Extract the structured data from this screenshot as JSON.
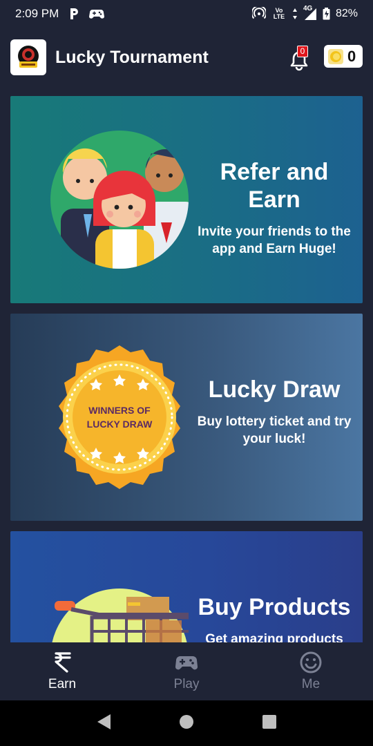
{
  "status_bar": {
    "time": "2:09 PM",
    "network": "4G",
    "volte": "Vo LTE",
    "battery": "82%",
    "icons": [
      "parking-icon",
      "gamepad-icon",
      "hotspot-icon",
      "volte-icon",
      "signal-icon",
      "battery-icon"
    ]
  },
  "app_bar": {
    "title": "Lucky Tournament",
    "notification_count": "0",
    "coin_balance": "0"
  },
  "cards": [
    {
      "title": "Refer and Earn",
      "description": "Invite your friends to the app and Earn Huge!",
      "art": "people-illustration"
    },
    {
      "title": "Lucky Draw",
      "description": "Buy lottery ticket and try your luck!",
      "art": "medal-illustration",
      "medal_text": "WINNERS OF LUCKY DRAW"
    },
    {
      "title": "Buy Products",
      "description": "Get amazing products",
      "art": "shopping-cart-illustration"
    }
  ],
  "bottom_nav": [
    {
      "label": "Earn",
      "icon": "rupee-icon",
      "active": true
    },
    {
      "label": "Play",
      "icon": "gamepad-icon",
      "active": false
    },
    {
      "label": "Me",
      "icon": "smiley-icon",
      "active": false
    }
  ],
  "colors": {
    "background": "#1f2436",
    "badge": "#e0161c",
    "inactive_nav": "#7c8194"
  }
}
